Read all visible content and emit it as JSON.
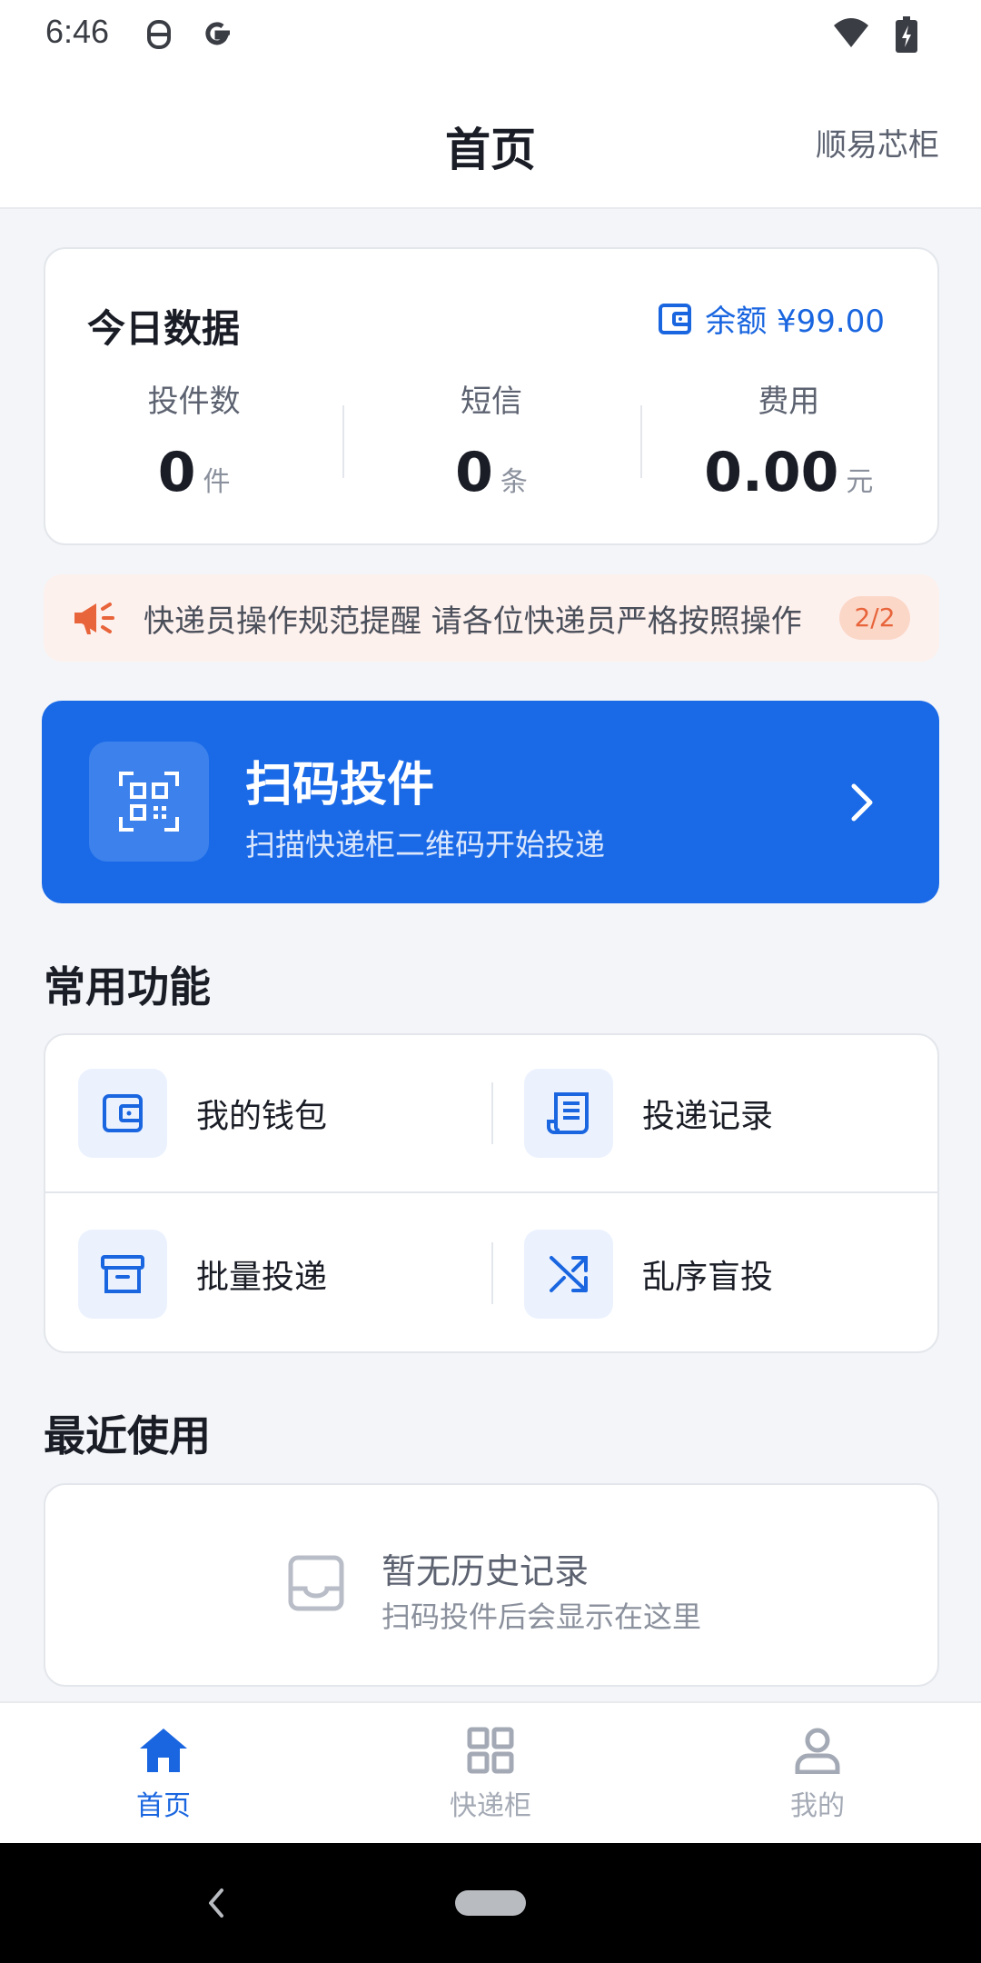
{
  "status_bar": {
    "time": "6:46"
  },
  "header": {
    "title": "首页",
    "brand": "顺易芯柜"
  },
  "today": {
    "title": "今日数据",
    "balance_text": "余额 ¥99.00",
    "stats": [
      {
        "label": "投件数",
        "value": "0",
        "unit": "件"
      },
      {
        "label": "短信",
        "value": "0",
        "unit": "条"
      },
      {
        "label": "费用",
        "value": "0.00",
        "unit": "元"
      }
    ]
  },
  "notice": {
    "text": "快递员操作规范提醒 请各位快递员严格按照操作",
    "page": "2/2"
  },
  "scan": {
    "title": "扫码投件",
    "subtitle": "扫描快递柜二维码开始投递"
  },
  "functions": {
    "title": "常用功能",
    "items": [
      {
        "label": "我的钱包",
        "icon": "wallet-icon"
      },
      {
        "label": "投递记录",
        "icon": "receipt-icon"
      },
      {
        "label": "批量投递",
        "icon": "archive-box-icon"
      },
      {
        "label": "乱序盲投",
        "icon": "shuffle-icon"
      }
    ]
  },
  "recent": {
    "title": "最近使用",
    "empty_title": "暂无历史记录",
    "empty_subtitle": "扫码投件后会显示在这里"
  },
  "bottom_nav": {
    "items": [
      {
        "label": "首页",
        "icon": "home-icon",
        "active": true
      },
      {
        "label": "快递柜",
        "icon": "grid-icon",
        "active": false
      },
      {
        "label": "我的",
        "icon": "user-icon",
        "active": false
      }
    ]
  },
  "colors": {
    "primary": "#1a6ae8",
    "accent_orange": "#e8643a",
    "background": "#f3f5f8"
  }
}
